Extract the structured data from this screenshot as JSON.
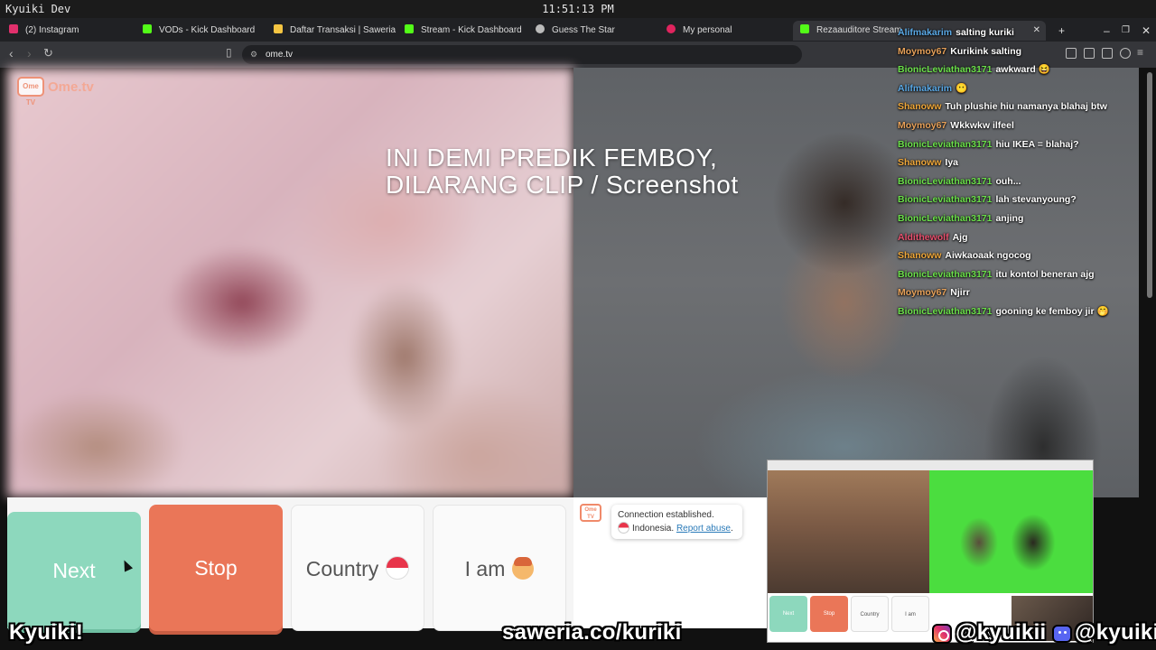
{
  "os": {
    "user": "Kyuiki Dev",
    "clock": "11:51:13 PM"
  },
  "tabs": [
    {
      "label": "(2) Instagram",
      "color": "#e1306c"
    },
    {
      "label": "VODs - Kick Dashboard",
      "color": "#53fc18"
    },
    {
      "label": "Daftar Transaksi | Saweria",
      "color": "#f5c542"
    },
    {
      "label": "Stream - Kick Dashboard",
      "color": "#53fc18"
    },
    {
      "label": "Guess The Star",
      "color": "#bbbbbb"
    },
    {
      "label": "My personal",
      "color": "#e0245e"
    },
    {
      "label": "Rezaauditore Stream -",
      "color": "#53fc18"
    }
  ],
  "address": {
    "url": "ome.tv"
  },
  "logo": {
    "box": "Ome TV",
    "text": "Ome.tv"
  },
  "overlay": {
    "line1": "INI DEMI PREDIK FEMBOY,",
    "line2": "DILARANG CLIP / Screenshot"
  },
  "chat": [
    {
      "user": "Alifmakarim",
      "color": "#5aa9e6",
      "text": "salting kuriki"
    },
    {
      "user": "Moymoy67",
      "color": "#e8a25a",
      "text": "Kurikink salting"
    },
    {
      "user": "BionicLeviathan3171",
      "color": "#6be04a",
      "text": "awkward 😆"
    },
    {
      "user": "Alifmakarim",
      "color": "#5aa9e6",
      "text": "😶"
    },
    {
      "user": "Shanoww",
      "color": "#f0a83a",
      "text": "Tuh plushie hiu namanya blahaj btw"
    },
    {
      "user": "Moymoy67",
      "color": "#e8a25a",
      "text": "Wkkwkw ilfeel"
    },
    {
      "user": "BionicLeviathan3171",
      "color": "#6be04a",
      "text": "hiu IKEA = blahaj?"
    },
    {
      "user": "Shanoww",
      "color": "#f0a83a",
      "text": "Iya"
    },
    {
      "user": "BionicLeviathan3171",
      "color": "#6be04a",
      "text": "ouh..."
    },
    {
      "user": "BionicLeviathan3171",
      "color": "#6be04a",
      "text": "lah stevanyoung?"
    },
    {
      "user": "BionicLeviathan3171",
      "color": "#6be04a",
      "text": "anjing"
    },
    {
      "user": "Aldithewolf",
      "color": "#e8506e",
      "text": "Ajg"
    },
    {
      "user": "Shanoww",
      "color": "#f0a83a",
      "text": "Aiwkaoaak ngocog"
    },
    {
      "user": "BionicLeviathan3171",
      "color": "#6be04a",
      "text": "itu kontol beneran ajg"
    },
    {
      "user": "Moymoy67",
      "color": "#e8a25a",
      "text": "Njirr"
    },
    {
      "user": "BionicLeviathan3171",
      "color": "#6be04a",
      "text": "gooning ke femboy jir 🤭"
    }
  ],
  "controls": {
    "next": "Next",
    "stop": "Stop",
    "country": "Country",
    "iam": "I am"
  },
  "status": {
    "line1": "Connection established.",
    "country": "Indonesia.",
    "report": "Report abuse",
    "end": "."
  },
  "pip": {
    "next": "Next",
    "stop": "Stop",
    "country": "Country",
    "iam": "I am"
  },
  "banner": {
    "left": "Kyuiki!",
    "center": "saweria.co/kuriki",
    "ig": "@kyuikii",
    "discord": "@kyuiki"
  }
}
